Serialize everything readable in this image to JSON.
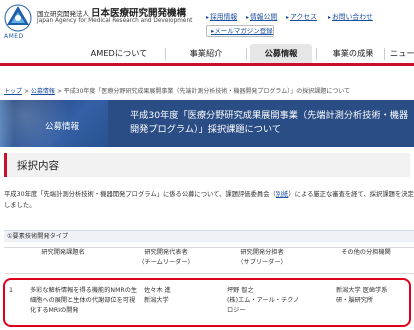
{
  "header": {
    "logo_caption": "AMED",
    "org_prefix": "国立研究開発法人",
    "org_name": "日本医療研究開発機構",
    "org_english": "Japan Agency for Medical Research and Development",
    "utility_links": [
      "採用情報",
      "情報公開",
      "アクセス",
      "お問い合わせ"
    ],
    "mail_magazine": "メールマガジン登録"
  },
  "nav": {
    "items": [
      "AMEDについて",
      "事業紹介",
      "公募情報",
      "事業の成果",
      "ニュー"
    ],
    "active_index": 2
  },
  "breadcrumb": {
    "home": "トップ",
    "parent": "公募情報",
    "current": "平成30年度「医療分野研究成果展開事業（先端計測分析技術・機器開発プログラム）」の採択課題について"
  },
  "banner": {
    "section": "公募情報",
    "title": "平成30年度「医療分野研究成果展開事業（先端計測分析技術・機器開発プログラム）」採択課題について"
  },
  "heading": "採択内容",
  "intro": {
    "text_before": "平成30年度「先端計測分析技術・機器開発プログラム」に係る公募について、課題評価委員会（",
    "link": "別紙",
    "text_after": "）による厳正な審査を経て、採択課題を決定しました。"
  },
  "table": {
    "title": "①要素技術開発タイプ",
    "headers": {
      "col1": "研究開発課題名",
      "col2_line1": "研究開発代表者",
      "col2_line2": "（チームリーダー）",
      "col3_line1": "研究開発分担者",
      "col3_line2": "（サブリーダー）",
      "col4": "その他の分担機関"
    },
    "rows": [
      {
        "num": "1",
        "title_lines": [
          "多彩な解析情報を得る機能的NMRの生",
          "細胞への展開と生体の代謝部位を可視",
          "化するMRIの開発"
        ],
        "leader_lines": [
          "佐々木 進",
          "新潟大学"
        ],
        "sub_lines": [
          "坪野 智之",
          "(株)エム・アール・テクノ",
          "ロジー"
        ],
        "others_lines": [
          "新潟大学 医歯学系",
          "研・脳研究所"
        ]
      }
    ]
  },
  "colors": {
    "accent_red": "#c8102e",
    "link_blue": "#1a4fa0",
    "banner_blue": "#2a4d86",
    "highlight_red": "#e0001b"
  }
}
